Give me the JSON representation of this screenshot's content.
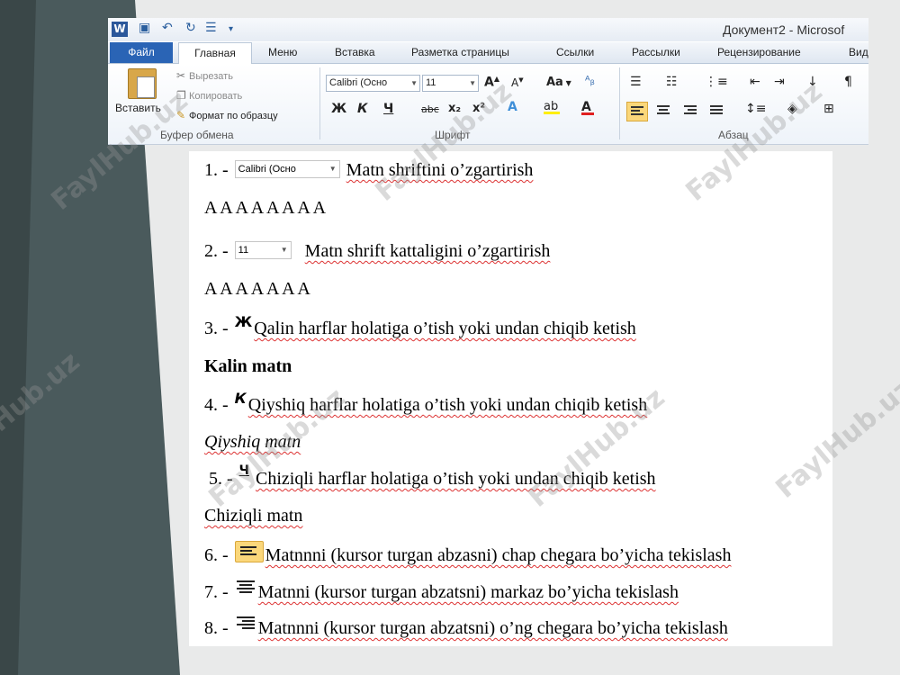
{
  "watermark": "FaylHub.uz",
  "app": {
    "word_icon": "W",
    "window_title": "Документ2  -  Microsof",
    "quick_access": [
      "save-icon",
      "undo-icon",
      "redo-icon",
      "list-icon",
      "customize-icon"
    ]
  },
  "ribbon": {
    "tabs": {
      "file": "Файл",
      "home": "Главная",
      "menu": "Меню",
      "insert": "Вставка",
      "layout": "Разметка страницы",
      "references": "Ссылки",
      "mailings": "Рассылки",
      "review": "Рецензирование",
      "view": "Вид"
    },
    "clipboard": {
      "paste": "Вставить",
      "cut": "Вырезать",
      "copy": "Копировать",
      "format_painter": "Формат по образцу",
      "group": "Буфер обмена"
    },
    "font": {
      "font_name": "Calibri (Осно",
      "font_size": "11",
      "case_label": "Aa",
      "bold": "Ж",
      "italic": "К",
      "underline": "Ч",
      "strike": "abc",
      "subscript": "x₂",
      "superscript": "x²",
      "group": "Шрифт"
    },
    "paragraph": {
      "group": "Абзац",
      "pilcrow": "¶"
    }
  },
  "document": {
    "item1_num": "1. -",
    "item1_combo": "Calibri (Осно",
    "item1_text": "Matn shriftini o’zgartirish",
    "sample1": "A A A A A A A A",
    "item2_num": "2. -",
    "item2_combo": "11",
    "item2_text": "Matn shrift kattaligini o’zgartirish",
    "sample2": "A A A A A A A",
    "item3_num": "3. -",
    "item3_icon": "Ж",
    "item3_text": "Qalin harflar holatiga o’tish yoki undan chiqib ketish",
    "sample3": "Kalin matn",
    "item4_num": "4. -",
    "item4_icon": "К",
    "item4_text": "Qiyshiq harflar holatiga o’tish yoki undan chiqib ketish",
    "sample4": "Qiyshiq matn",
    "item5_num": "5. -",
    "item5_icon": "Ч",
    "item5_text": "Chiziqli harflar holatiga o’tish yoki undan chiqib ketish",
    "sample5": "Chiziqli matn",
    "item6_num": "6. -",
    "item6_text": "Matnnni (kursor turgan abzasni) chap chegara bo’yicha tekislash",
    "item7_num": "7. -",
    "item7_text": "Matnni (kursor turgan abzatsni) markaz bo’yicha tekislash",
    "item8_num": "8. -",
    "item8_text": "Matnnni (kursor turgan abzatsni) o’ng chegara bo’yicha tekislash"
  },
  "colors": {
    "slide_dark": "#4a5a5c",
    "file_tab": "#2a64b5",
    "highlight": "#fbd77a"
  }
}
